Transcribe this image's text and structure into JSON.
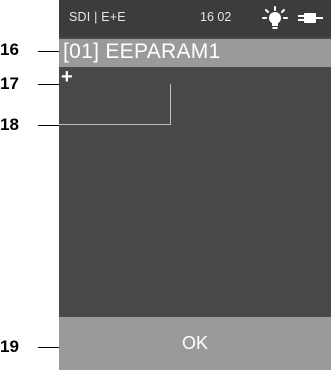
{
  "status_bar": {
    "mode": "SDI | E+E",
    "time": "16 02",
    "icons": [
      "bulb-icon",
      "plug-icon"
    ]
  },
  "screen": {
    "title": "[01] EEPARAM1",
    "marker": "+",
    "ok_label": "OK"
  },
  "callouts": [
    "16",
    "17",
    "18",
    "19"
  ],
  "colors": {
    "screen_bg": "#484848",
    "status_bg": "#3c3c3c",
    "highlight": "#9a9a9a",
    "text": "#ffffff"
  }
}
